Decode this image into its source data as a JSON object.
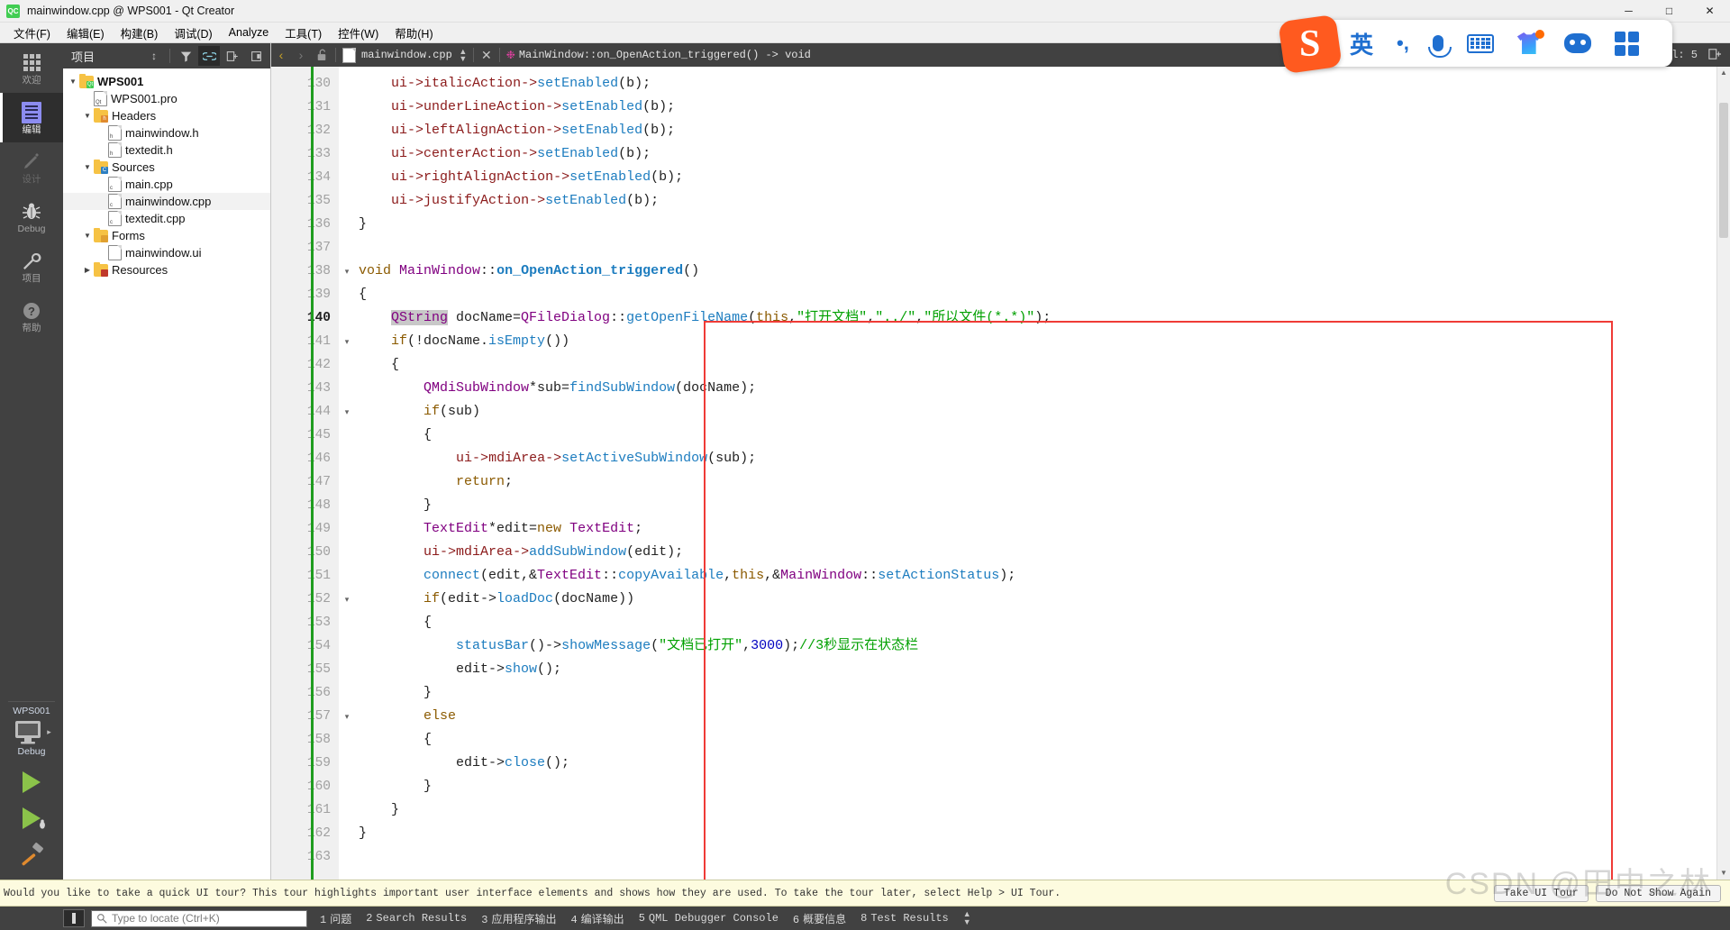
{
  "window": {
    "title": "mainwindow.cpp @ WPS001 - Qt Creator",
    "app_icon": "QC",
    "minimize": "─",
    "maximize": "□",
    "close": "✕"
  },
  "menubar": {
    "items": [
      {
        "label": "文件(F)"
      },
      {
        "label": "编辑(E)"
      },
      {
        "label": "构建(B)"
      },
      {
        "label": "调试(D)"
      },
      {
        "label": "Analyze"
      },
      {
        "label": "工具(T)"
      },
      {
        "label": "控件(W)"
      },
      {
        "label": "帮助(H)"
      }
    ]
  },
  "modebar": {
    "items": [
      {
        "label": "欢迎",
        "icon": "grid-icon",
        "active": false
      },
      {
        "label": "编辑",
        "icon": "edit-icon",
        "active": true
      },
      {
        "label": "设计",
        "icon": "pencil-icon",
        "active": false
      },
      {
        "label": "Debug",
        "icon": "bug-icon",
        "active": false
      },
      {
        "label": "项目",
        "icon": "wrench-icon",
        "active": false
      },
      {
        "label": "帮助",
        "icon": "question-icon",
        "active": false
      }
    ],
    "kit_name": "WPS001",
    "kit_config": "Debug",
    "run_tooltip": "Run",
    "debug_tooltip": "Start Debugging",
    "build_tooltip": "Build"
  },
  "project_panel": {
    "title": "项目",
    "tools": [
      "sort-icon",
      "filter-icon",
      "link-icon",
      "split-icon",
      "close-panel-icon"
    ],
    "tree": [
      {
        "label": "WPS001",
        "depth": 0,
        "twisty": "▼",
        "icon": "folder-qt",
        "bold": true
      },
      {
        "label": "WPS001.pro",
        "depth": 1,
        "twisty": "",
        "icon": "doc-pro",
        "bold": false
      },
      {
        "label": "Headers",
        "depth": 1,
        "twisty": "▼",
        "icon": "folder-h",
        "bold": false
      },
      {
        "label": "mainwindow.h",
        "depth": 2,
        "twisty": "",
        "icon": "doc-h",
        "bold": false
      },
      {
        "label": "textedit.h",
        "depth": 2,
        "twisty": "",
        "icon": "doc-h",
        "bold": false
      },
      {
        "label": "Sources",
        "depth": 1,
        "twisty": "▼",
        "icon": "folder-cpp",
        "bold": false
      },
      {
        "label": "main.cpp",
        "depth": 2,
        "twisty": "",
        "icon": "doc-cpp",
        "bold": false
      },
      {
        "label": "mainwindow.cpp",
        "depth": 2,
        "twisty": "",
        "icon": "doc-cpp",
        "bold": false,
        "selected": true
      },
      {
        "label": "textedit.cpp",
        "depth": 2,
        "twisty": "",
        "icon": "doc-cpp",
        "bold": false
      },
      {
        "label": "Forms",
        "depth": 1,
        "twisty": "▼",
        "icon": "folder-ui",
        "bold": false
      },
      {
        "label": "mainwindow.ui",
        "depth": 2,
        "twisty": "",
        "icon": "doc-ui",
        "bold": false
      },
      {
        "label": "Resources",
        "depth": 1,
        "twisty": "▶",
        "icon": "folder-res",
        "bold": false
      }
    ]
  },
  "editor_toolbar": {
    "back": "‹",
    "forward": "›",
    "lock_icon": "unlock-icon",
    "file_combo": "mainwindow.cpp",
    "symbol_combo": "MainWindow::on_OpenAction_triggered() -> void",
    "close_icon": "✕",
    "line_col": "0, Col: 5",
    "split_icon": "split-editor-icon"
  },
  "editor": {
    "first_line": 130,
    "current_line": 140,
    "lines": [
      {
        "n": 130,
        "fold": "",
        "tokens": [
          {
            "t": "    ",
            "c": "t-plain"
          },
          {
            "t": "ui",
            "c": "t-mem"
          },
          {
            "t": "->",
            "c": "t-mem"
          },
          {
            "t": "italicAction",
            "c": "t-mem"
          },
          {
            "t": "->",
            "c": "t-mem"
          },
          {
            "t": "setEnabled",
            "c": "t-func"
          },
          {
            "t": "(b);",
            "c": "t-plain"
          }
        ]
      },
      {
        "n": 131,
        "fold": "",
        "tokens": [
          {
            "t": "    ",
            "c": "t-plain"
          },
          {
            "t": "ui",
            "c": "t-mem"
          },
          {
            "t": "->",
            "c": "t-mem"
          },
          {
            "t": "underLineAction",
            "c": "t-mem"
          },
          {
            "t": "->",
            "c": "t-mem"
          },
          {
            "t": "setEnabled",
            "c": "t-func"
          },
          {
            "t": "(b);",
            "c": "t-plain"
          }
        ]
      },
      {
        "n": 132,
        "fold": "",
        "tokens": [
          {
            "t": "    ",
            "c": "t-plain"
          },
          {
            "t": "ui",
            "c": "t-mem"
          },
          {
            "t": "->",
            "c": "t-mem"
          },
          {
            "t": "leftAlignAction",
            "c": "t-mem"
          },
          {
            "t": "->",
            "c": "t-mem"
          },
          {
            "t": "setEnabled",
            "c": "t-func"
          },
          {
            "t": "(b);",
            "c": "t-plain"
          }
        ]
      },
      {
        "n": 133,
        "fold": "",
        "tokens": [
          {
            "t": "    ",
            "c": "t-plain"
          },
          {
            "t": "ui",
            "c": "t-mem"
          },
          {
            "t": "->",
            "c": "t-mem"
          },
          {
            "t": "centerAction",
            "c": "t-mem"
          },
          {
            "t": "->",
            "c": "t-mem"
          },
          {
            "t": "setEnabled",
            "c": "t-func"
          },
          {
            "t": "(b);",
            "c": "t-plain"
          }
        ]
      },
      {
        "n": 134,
        "fold": "",
        "tokens": [
          {
            "t": "    ",
            "c": "t-plain"
          },
          {
            "t": "ui",
            "c": "t-mem"
          },
          {
            "t": "->",
            "c": "t-mem"
          },
          {
            "t": "rightAlignAction",
            "c": "t-mem"
          },
          {
            "t": "->",
            "c": "t-mem"
          },
          {
            "t": "setEnabled",
            "c": "t-func"
          },
          {
            "t": "(b);",
            "c": "t-plain"
          }
        ]
      },
      {
        "n": 135,
        "fold": "",
        "tokens": [
          {
            "t": "    ",
            "c": "t-plain"
          },
          {
            "t": "ui",
            "c": "t-mem"
          },
          {
            "t": "->",
            "c": "t-mem"
          },
          {
            "t": "justifyAction",
            "c": "t-mem"
          },
          {
            "t": "->",
            "c": "t-mem"
          },
          {
            "t": "setEnabled",
            "c": "t-func"
          },
          {
            "t": "(b);",
            "c": "t-plain"
          }
        ]
      },
      {
        "n": 136,
        "fold": "",
        "tokens": [
          {
            "t": "}",
            "c": "t-plain"
          }
        ]
      },
      {
        "n": 137,
        "fold": "",
        "tokens": [
          {
            "t": "",
            "c": "t-plain"
          }
        ]
      },
      {
        "n": 138,
        "fold": "·",
        "tokens": [
          {
            "t": "void",
            "c": "t-kw"
          },
          {
            "t": " ",
            "c": "t-plain"
          },
          {
            "t": "MainWindow",
            "c": "t-type"
          },
          {
            "t": "::",
            "c": "t-plain"
          },
          {
            "t": "on_OpenAction_triggered",
            "c": "t-funcdef"
          },
          {
            "t": "()",
            "c": "t-plain"
          }
        ]
      },
      {
        "n": 139,
        "fold": "",
        "tokens": [
          {
            "t": "{",
            "c": "t-plain"
          }
        ]
      },
      {
        "n": 140,
        "fold": "",
        "tokens": [
          {
            "t": "    ",
            "c": "t-plain"
          },
          {
            "t": "QString",
            "c": "t-sel"
          },
          {
            "t": " docName=",
            "c": "t-plain"
          },
          {
            "t": "QFileDialog",
            "c": "t-type"
          },
          {
            "t": "::",
            "c": "t-plain"
          },
          {
            "t": "getOpenFileName",
            "c": "t-func"
          },
          {
            "t": "(",
            "c": "t-plain"
          },
          {
            "t": "this",
            "c": "t-this"
          },
          {
            "t": ",",
            "c": "t-plain"
          },
          {
            "t": "\"打开文档\"",
            "c": "t-str"
          },
          {
            "t": ",",
            "c": "t-plain"
          },
          {
            "t": "\"../\"",
            "c": "t-str"
          },
          {
            "t": ",",
            "c": "t-plain"
          },
          {
            "t": "\"所以文件(*.*)\"",
            "c": "t-str"
          },
          {
            "t": ");",
            "c": "t-plain"
          }
        ]
      },
      {
        "n": 141,
        "fold": "·",
        "tokens": [
          {
            "t": "    ",
            "c": "t-plain"
          },
          {
            "t": "if",
            "c": "t-kw"
          },
          {
            "t": "(!docName.",
            "c": "t-plain"
          },
          {
            "t": "isEmpty",
            "c": "t-func"
          },
          {
            "t": "())",
            "c": "t-plain"
          }
        ]
      },
      {
        "n": 142,
        "fold": "",
        "tokens": [
          {
            "t": "    {",
            "c": "t-plain"
          }
        ]
      },
      {
        "n": 143,
        "fold": "",
        "tokens": [
          {
            "t": "        ",
            "c": "t-plain"
          },
          {
            "t": "QMdiSubWindow",
            "c": "t-type"
          },
          {
            "t": "*sub=",
            "c": "t-plain"
          },
          {
            "t": "findSubWindow",
            "c": "t-func"
          },
          {
            "t": "(docName);",
            "c": "t-plain"
          }
        ]
      },
      {
        "n": 144,
        "fold": "·",
        "tokens": [
          {
            "t": "        ",
            "c": "t-plain"
          },
          {
            "t": "if",
            "c": "t-kw"
          },
          {
            "t": "(sub)",
            "c": "t-plain"
          }
        ]
      },
      {
        "n": 145,
        "fold": "",
        "tokens": [
          {
            "t": "        {",
            "c": "t-plain"
          }
        ]
      },
      {
        "n": 146,
        "fold": "",
        "tokens": [
          {
            "t": "            ",
            "c": "t-plain"
          },
          {
            "t": "ui",
            "c": "t-mem"
          },
          {
            "t": "->",
            "c": "t-mem"
          },
          {
            "t": "mdiArea",
            "c": "t-mem"
          },
          {
            "t": "->",
            "c": "t-mem"
          },
          {
            "t": "setActiveSubWindow",
            "c": "t-func"
          },
          {
            "t": "(sub);",
            "c": "t-plain"
          }
        ]
      },
      {
        "n": 147,
        "fold": "",
        "tokens": [
          {
            "t": "            ",
            "c": "t-plain"
          },
          {
            "t": "return",
            "c": "t-kw"
          },
          {
            "t": ";",
            "c": "t-plain"
          }
        ]
      },
      {
        "n": 148,
        "fold": "",
        "tokens": [
          {
            "t": "        }",
            "c": "t-plain"
          }
        ]
      },
      {
        "n": 149,
        "fold": "",
        "tokens": [
          {
            "t": "        ",
            "c": "t-plain"
          },
          {
            "t": "TextEdit",
            "c": "t-type"
          },
          {
            "t": "*edit=",
            "c": "t-plain"
          },
          {
            "t": "new",
            "c": "t-kw"
          },
          {
            "t": " ",
            "c": "t-plain"
          },
          {
            "t": "TextEdit",
            "c": "t-type"
          },
          {
            "t": ";",
            "c": "t-plain"
          }
        ]
      },
      {
        "n": 150,
        "fold": "",
        "tokens": [
          {
            "t": "        ",
            "c": "t-plain"
          },
          {
            "t": "ui",
            "c": "t-mem"
          },
          {
            "t": "->",
            "c": "t-mem"
          },
          {
            "t": "mdiArea",
            "c": "t-mem"
          },
          {
            "t": "->",
            "c": "t-mem"
          },
          {
            "t": "addSubWindow",
            "c": "t-func"
          },
          {
            "t": "(edit);",
            "c": "t-plain"
          }
        ]
      },
      {
        "n": 151,
        "fold": "",
        "tokens": [
          {
            "t": "        ",
            "c": "t-plain"
          },
          {
            "t": "connect",
            "c": "t-func"
          },
          {
            "t": "(edit,&",
            "c": "t-plain"
          },
          {
            "t": "TextEdit",
            "c": "t-type"
          },
          {
            "t": "::",
            "c": "t-plain"
          },
          {
            "t": "copyAvailable",
            "c": "t-func"
          },
          {
            "t": ",",
            "c": "t-plain"
          },
          {
            "t": "this",
            "c": "t-this"
          },
          {
            "t": ",&",
            "c": "t-plain"
          },
          {
            "t": "MainWindow",
            "c": "t-type"
          },
          {
            "t": "::",
            "c": "t-plain"
          },
          {
            "t": "setActionStatus",
            "c": "t-func"
          },
          {
            "t": ");",
            "c": "t-plain"
          }
        ]
      },
      {
        "n": 152,
        "fold": "·",
        "tokens": [
          {
            "t": "        ",
            "c": "t-plain"
          },
          {
            "t": "if",
            "c": "t-kw"
          },
          {
            "t": "(edit->",
            "c": "t-plain"
          },
          {
            "t": "loadDoc",
            "c": "t-func"
          },
          {
            "t": "(docName))",
            "c": "t-plain"
          }
        ]
      },
      {
        "n": 153,
        "fold": "",
        "tokens": [
          {
            "t": "        {",
            "c": "t-plain"
          }
        ]
      },
      {
        "n": 154,
        "fold": "",
        "tokens": [
          {
            "t": "            ",
            "c": "t-plain"
          },
          {
            "t": "statusBar",
            "c": "t-func"
          },
          {
            "t": "()->",
            "c": "t-plain"
          },
          {
            "t": "showMessage",
            "c": "t-func"
          },
          {
            "t": "(",
            "c": "t-plain"
          },
          {
            "t": "\"文档已打开\"",
            "c": "t-str"
          },
          {
            "t": ",",
            "c": "t-plain"
          },
          {
            "t": "3000",
            "c": "t-num"
          },
          {
            "t": ");",
            "c": "t-plain"
          },
          {
            "t": "//3秒显示在状态栏",
            "c": "t-cmt"
          }
        ]
      },
      {
        "n": 155,
        "fold": "",
        "tokens": [
          {
            "t": "            edit->",
            "c": "t-plain"
          },
          {
            "t": "show",
            "c": "t-func"
          },
          {
            "t": "();",
            "c": "t-plain"
          }
        ]
      },
      {
        "n": 156,
        "fold": "",
        "tokens": [
          {
            "t": "        }",
            "c": "t-plain"
          }
        ]
      },
      {
        "n": 157,
        "fold": "·",
        "tokens": [
          {
            "t": "        ",
            "c": "t-plain"
          },
          {
            "t": "else",
            "c": "t-kw"
          }
        ]
      },
      {
        "n": 158,
        "fold": "",
        "tokens": [
          {
            "t": "        {",
            "c": "t-plain"
          }
        ]
      },
      {
        "n": 159,
        "fold": "",
        "tokens": [
          {
            "t": "            edit->",
            "c": "t-plain"
          },
          {
            "t": "close",
            "c": "t-func"
          },
          {
            "t": "();",
            "c": "t-plain"
          }
        ]
      },
      {
        "n": 160,
        "fold": "",
        "tokens": [
          {
            "t": "        }",
            "c": "t-plain"
          }
        ]
      },
      {
        "n": 161,
        "fold": "",
        "tokens": [
          {
            "t": "    }",
            "c": "t-plain"
          }
        ]
      },
      {
        "n": 162,
        "fold": "",
        "tokens": [
          {
            "t": "}",
            "c": "t-plain"
          }
        ]
      },
      {
        "n": 163,
        "fold": "",
        "tokens": [
          {
            "t": "",
            "c": "t-plain"
          }
        ]
      }
    ]
  },
  "tour_bar": {
    "message": "Would you like to take a quick UI tour? This tour highlights important user interface elements and shows how they are used. To take the tour later, select Help > UI Tour.",
    "take_tour": "Take UI Tour",
    "do_not_show": "Do Not Show Again"
  },
  "statusbar": {
    "locator_placeholder": "Type to locate (Ctrl+K)",
    "panels": [
      {
        "idx": "1",
        "label": "问题"
      },
      {
        "idx": "2",
        "label": "Search Results"
      },
      {
        "idx": "3",
        "label": "应用程序输出"
      },
      {
        "idx": "4",
        "label": "编译输出"
      },
      {
        "idx": "5",
        "label": "QML Debugger Console"
      },
      {
        "idx": "6",
        "label": "概要信息"
      },
      {
        "idx": "8",
        "label": "Test Results"
      }
    ]
  },
  "ime": {
    "name": "sogou-ime-toolbar",
    "mode_label": "英",
    "punct_label": "•,",
    "items": [
      "mode-toggle",
      "punctuation-toggle",
      "voice-input-icon",
      "keyboard-icon",
      "skin-icon",
      "game-icon",
      "apps-icon"
    ]
  },
  "watermark": {
    "text": "CSDN @田中之林"
  },
  "colors": {
    "accent_red": "#ef3b36",
    "dark_chrome": "#414141",
    "string_green": "#00a000",
    "sogou_orange": "#ff5a1f",
    "ime_blue": "#1f6fd0"
  }
}
